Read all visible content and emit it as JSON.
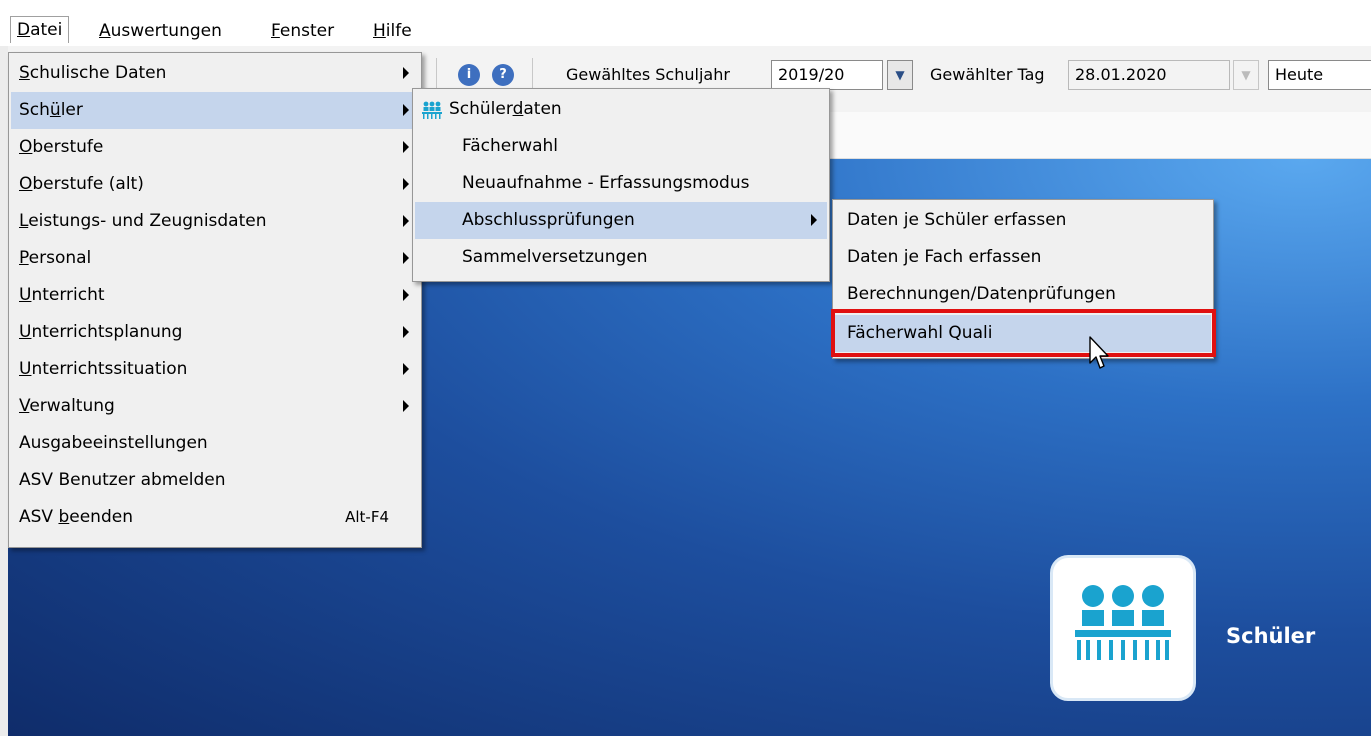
{
  "menubar": {
    "items": [
      {
        "pre": "",
        "u": "D",
        "post": "atei"
      },
      {
        "pre": "",
        "u": "A",
        "post": "uswertungen"
      },
      {
        "pre": "",
        "u": "F",
        "post": "enster"
      },
      {
        "pre": "",
        "u": "H",
        "post": "ilfe"
      }
    ]
  },
  "toolbar": {
    "schuljahr_label": "Gewähltes Schuljahr",
    "schuljahr_value": "2019/20",
    "tag_label": "Gewählter Tag",
    "tag_value": "28.01.2020",
    "heute_value": "Heute"
  },
  "datei_menu": {
    "items": [
      {
        "pre": "",
        "u": "S",
        "post": "chulische Daten",
        "sub": true
      },
      {
        "pre": "Sch",
        "u": "ü",
        "post": "ler",
        "sub": true
      },
      {
        "pre": "",
        "u": "O",
        "post": "berstufe",
        "sub": true
      },
      {
        "pre": "",
        "u": "O",
        "post": "berstufe (alt)",
        "sub": true
      },
      {
        "pre": "",
        "u": "L",
        "post": "eistungs- und Zeugnisdaten",
        "sub": true
      },
      {
        "pre": "",
        "u": "P",
        "post": "ersonal",
        "sub": true
      },
      {
        "pre": "",
        "u": "U",
        "post": "nterricht",
        "sub": true
      },
      {
        "pre": "",
        "u": "U",
        "post": "nterrichtsplanung",
        "sub": true
      },
      {
        "pre": "",
        "u": "U",
        "post": "nterrichtssituation",
        "sub": true
      },
      {
        "pre": "",
        "u": "V",
        "post": "erwaltung",
        "sub": true
      },
      {
        "pre": "Ausgabeeinstellungen",
        "u": "",
        "post": "",
        "sub": false
      },
      {
        "pre": "ASV Benutzer abmelden",
        "u": "",
        "post": "",
        "sub": false
      },
      {
        "pre": "ASV ",
        "u": "b",
        "post": "eenden",
        "sub": false,
        "accel": "Alt-F4"
      }
    ]
  },
  "schueler_menu": {
    "items": [
      {
        "pre": "Schüler",
        "u": "d",
        "post": "aten",
        "icon": true
      },
      {
        "pre": "Fächerwahl",
        "u": "",
        "post": ""
      },
      {
        "pre": "Neuaufnahme - Erfassungsmodus",
        "u": "",
        "post": ""
      },
      {
        "pre": "Abschlussprüfungen",
        "u": "",
        "post": "",
        "sub": true
      },
      {
        "pre": "Sammelversetzungen",
        "u": "",
        "post": ""
      }
    ]
  },
  "abschluss_menu": {
    "items": [
      {
        "label": "Daten je Schüler erfassen"
      },
      {
        "label": "Daten je Fach erfassen"
      },
      {
        "label": "Berechnungen/Datenprüfungen"
      },
      {
        "label": "Fächerwahl Quali"
      }
    ]
  },
  "tile": {
    "label": "Schüler"
  },
  "colors": {
    "menu_highlight": "#c5d5ec",
    "annotation_red": "#e01010",
    "tile_icon": "#1aa3cf"
  },
  "icons": [
    "info-icon",
    "help-icon",
    "dropdown-arrow-icon",
    "submenu-arrow-icon",
    "students-icon",
    "mouse-cursor-icon"
  ]
}
